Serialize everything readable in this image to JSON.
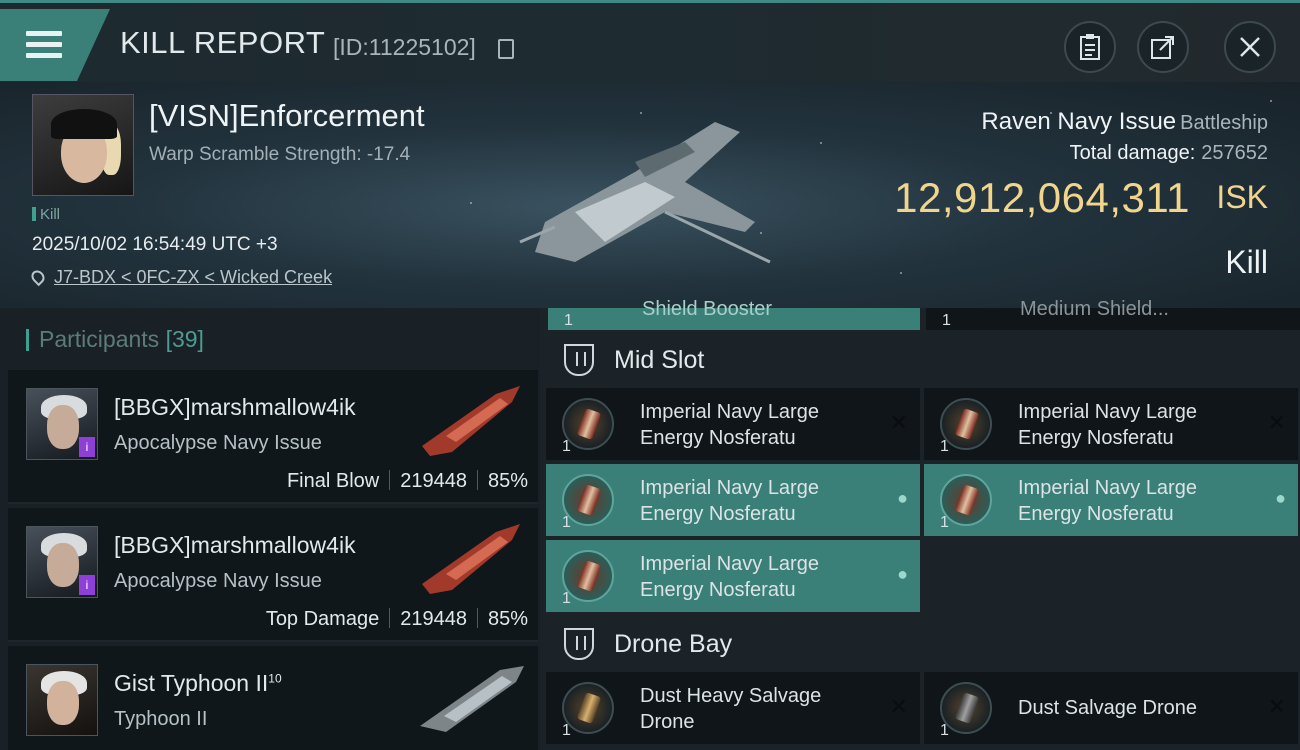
{
  "header": {
    "title": "KILL REPORT",
    "report_id": "[ID:11225102]"
  },
  "victim": {
    "name": "[VISN]Enforcerment",
    "warp_scramble": "Warp Scramble Strength: -17.4",
    "kill_tag": "Kill",
    "datetime": "2025/10/02 16:54:49 UTC +3",
    "location": "J7-BDX < 0FC-ZX < Wicked Creek",
    "ship_name": "Raven Navy Issue",
    "ship_class": "Battleship",
    "total_damage_label": "Total damage:",
    "total_damage_value": "257652",
    "isk_value": "12,912,064,311",
    "isk_unit": "ISK",
    "outcome": "Kill"
  },
  "participants": {
    "title": "Participants",
    "count": "[39]",
    "items": [
      {
        "name": "[BBGX]marshmallow4ik",
        "ship": "Apocalypse Navy Issue",
        "role": "Final Blow",
        "damage": "219448",
        "percent": "85%"
      },
      {
        "name": "[BBGX]marshmallow4ik",
        "ship": "Apocalypse Navy Issue",
        "role": "Top Damage",
        "damage": "219448",
        "percent": "85%"
      },
      {
        "name": "Gist Typhoon II",
        "name_sup": "10",
        "ship": "Typhoon II"
      }
    ]
  },
  "fittings": {
    "partial_top": [
      {
        "name": "Shield Booster",
        "qty": "1"
      },
      {
        "name": "Medium Shield...",
        "qty": "1"
      }
    ],
    "mid_slot": {
      "label": "Mid Slot",
      "items": [
        {
          "line1": "Imperial Navy Large",
          "line2": "Energy Nosferatu",
          "qty": "1",
          "state": "destroyed"
        },
        {
          "line1": "Imperial Navy Large",
          "line2": "Energy Nosferatu",
          "qty": "1",
          "state": "destroyed"
        },
        {
          "line1": "Imperial Navy Large",
          "line2": "Energy Nosferatu",
          "qty": "1",
          "state": "dropped"
        },
        {
          "line1": "Imperial Navy Large",
          "line2": "Energy Nosferatu",
          "qty": "1",
          "state": "dropped"
        },
        {
          "line1": "Imperial Navy Large",
          "line2": "Energy Nosferatu",
          "qty": "1",
          "state": "dropped"
        }
      ]
    },
    "drone_bay": {
      "label": "Drone Bay",
      "items": [
        {
          "line1": "Dust Heavy Salvage",
          "line2": "Drone",
          "qty": "1",
          "state": "destroyed"
        },
        {
          "line1": "Dust Salvage Drone",
          "qty": "1",
          "state": "destroyed"
        }
      ]
    }
  },
  "colors": {
    "accent": "#3b7f79",
    "isk": "#f1d58c",
    "implant_badge": "#8e3fd6"
  }
}
